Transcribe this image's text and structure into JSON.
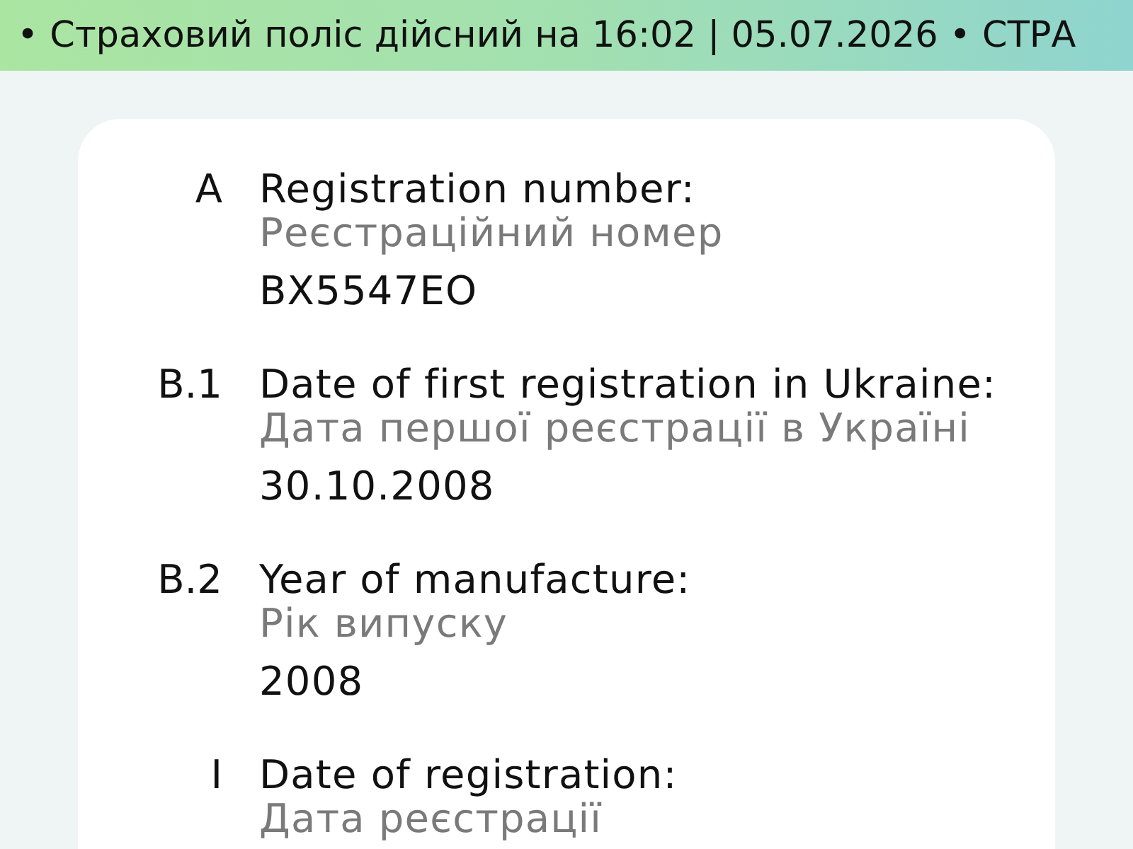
{
  "ticker": {
    "text": "• Страховий поліс дійсний на 16:02 | 05.07.2026 • СТРА"
  },
  "fields": [
    {
      "code": "A",
      "label": "Registration number:",
      "label_uk": "Реєстраційний номер",
      "value": "BX5547EO"
    },
    {
      "code": "B.1",
      "label": "Date of first registration in Ukraine:",
      "label_uk": "Дата першої реєстрації в Україні",
      "value": "30.10.2008"
    },
    {
      "code": "B.2",
      "label": "Year of manufacture:",
      "label_uk": "Рік випуску",
      "value": "2008"
    },
    {
      "code": "I",
      "label": "Date of registration:",
      "label_uk": "Дата реєстрації"
    }
  ]
}
